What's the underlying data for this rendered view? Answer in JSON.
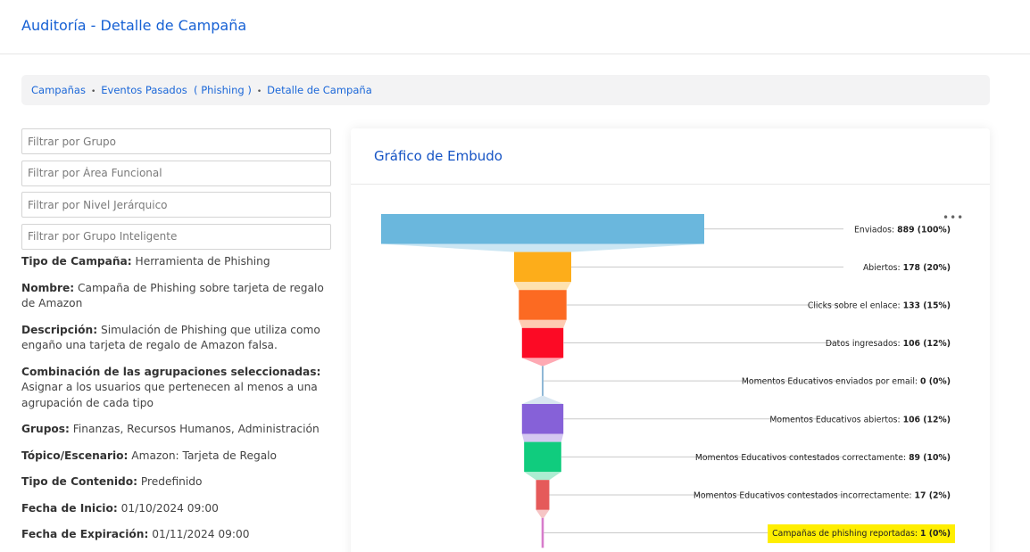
{
  "header": {
    "title": "Auditoría - Detalle de Campaña"
  },
  "breadcrumb": {
    "items": [
      "Campañas",
      "Eventos Pasados  ( Phishing )",
      "Detalle de Campaña"
    ],
    "separator": "•"
  },
  "filters": [
    {
      "placeholder": "Filtrar por Grupo",
      "value": ""
    },
    {
      "placeholder": "Filtrar por Área Funcional",
      "value": ""
    },
    {
      "placeholder": "Filtrar por Nivel Jerárquico",
      "value": ""
    },
    {
      "placeholder": "Filtrar por Grupo Inteligente",
      "value": ""
    }
  ],
  "details": [
    {
      "label": "Tipo de Campaña:",
      "value": "Herramienta de Phishing"
    },
    {
      "label": "Nombre:",
      "value": "Campaña de Phishing sobre tarjeta de regalo de Amazon"
    },
    {
      "label": "Descripción:",
      "value": "Simulación de Phishing que utiliza como engaño una tarjeta de regalo de Amazon falsa."
    },
    {
      "label": "Combinación de las agrupaciones seleccionadas:",
      "value": "Asignar a los usuarios que pertenecen al menos a una agrupación de cada tipo"
    },
    {
      "label": "Grupos:",
      "value": "Finanzas, Recursos Humanos, Administración"
    },
    {
      "label": "Tópico/Escenario:",
      "value": "Amazon: Tarjeta de Regalo"
    },
    {
      "label": "Tipo de Contenido:",
      "value": "Predefinido"
    },
    {
      "label": "Fecha de Inicio:",
      "value": "01/10/2024 09:00"
    },
    {
      "label": "Fecha de Expiración:",
      "value": "01/11/2024 09:00"
    }
  ],
  "chart_card": {
    "title": "Gráfico de Embudo",
    "menu_icon": "more-horizontal-icon",
    "menu_glyph": "•••"
  },
  "chart_data": {
    "type": "funnel",
    "total": 889,
    "stages": [
      {
        "name": "Enviados",
        "value": 889,
        "percent": "100%",
        "color": "#6ab7dd"
      },
      {
        "name": "Abiertos",
        "value": 178,
        "percent": "20%",
        "color": "#fdad1a"
      },
      {
        "name": "Clicks sobre el enlace",
        "value": 133,
        "percent": "15%",
        "color": "#fc6a22"
      },
      {
        "name": "Datos ingresados",
        "value": 106,
        "percent": "12%",
        "color": "#fc0a25"
      },
      {
        "name": "Momentos Educativos enviados por email",
        "value": 0,
        "percent": "0%",
        "color": "#8fb8d6"
      },
      {
        "name": "Momentos Educativos abiertos",
        "value": 106,
        "percent": "12%",
        "color": "#8661d8"
      },
      {
        "name": "Momentos Educativos contestados correctamente",
        "value": 89,
        "percent": "10%",
        "color": "#10cc7e"
      },
      {
        "name": "Momentos Educativos contestados incorrectamente",
        "value": 17,
        "percent": "2%",
        "color": "#e55a5a"
      },
      {
        "name": "Campañas de phishing reportadas",
        "value": 1,
        "percent": "0%",
        "color": "#d77ccb",
        "highlight": "#ffee00"
      }
    ]
  }
}
